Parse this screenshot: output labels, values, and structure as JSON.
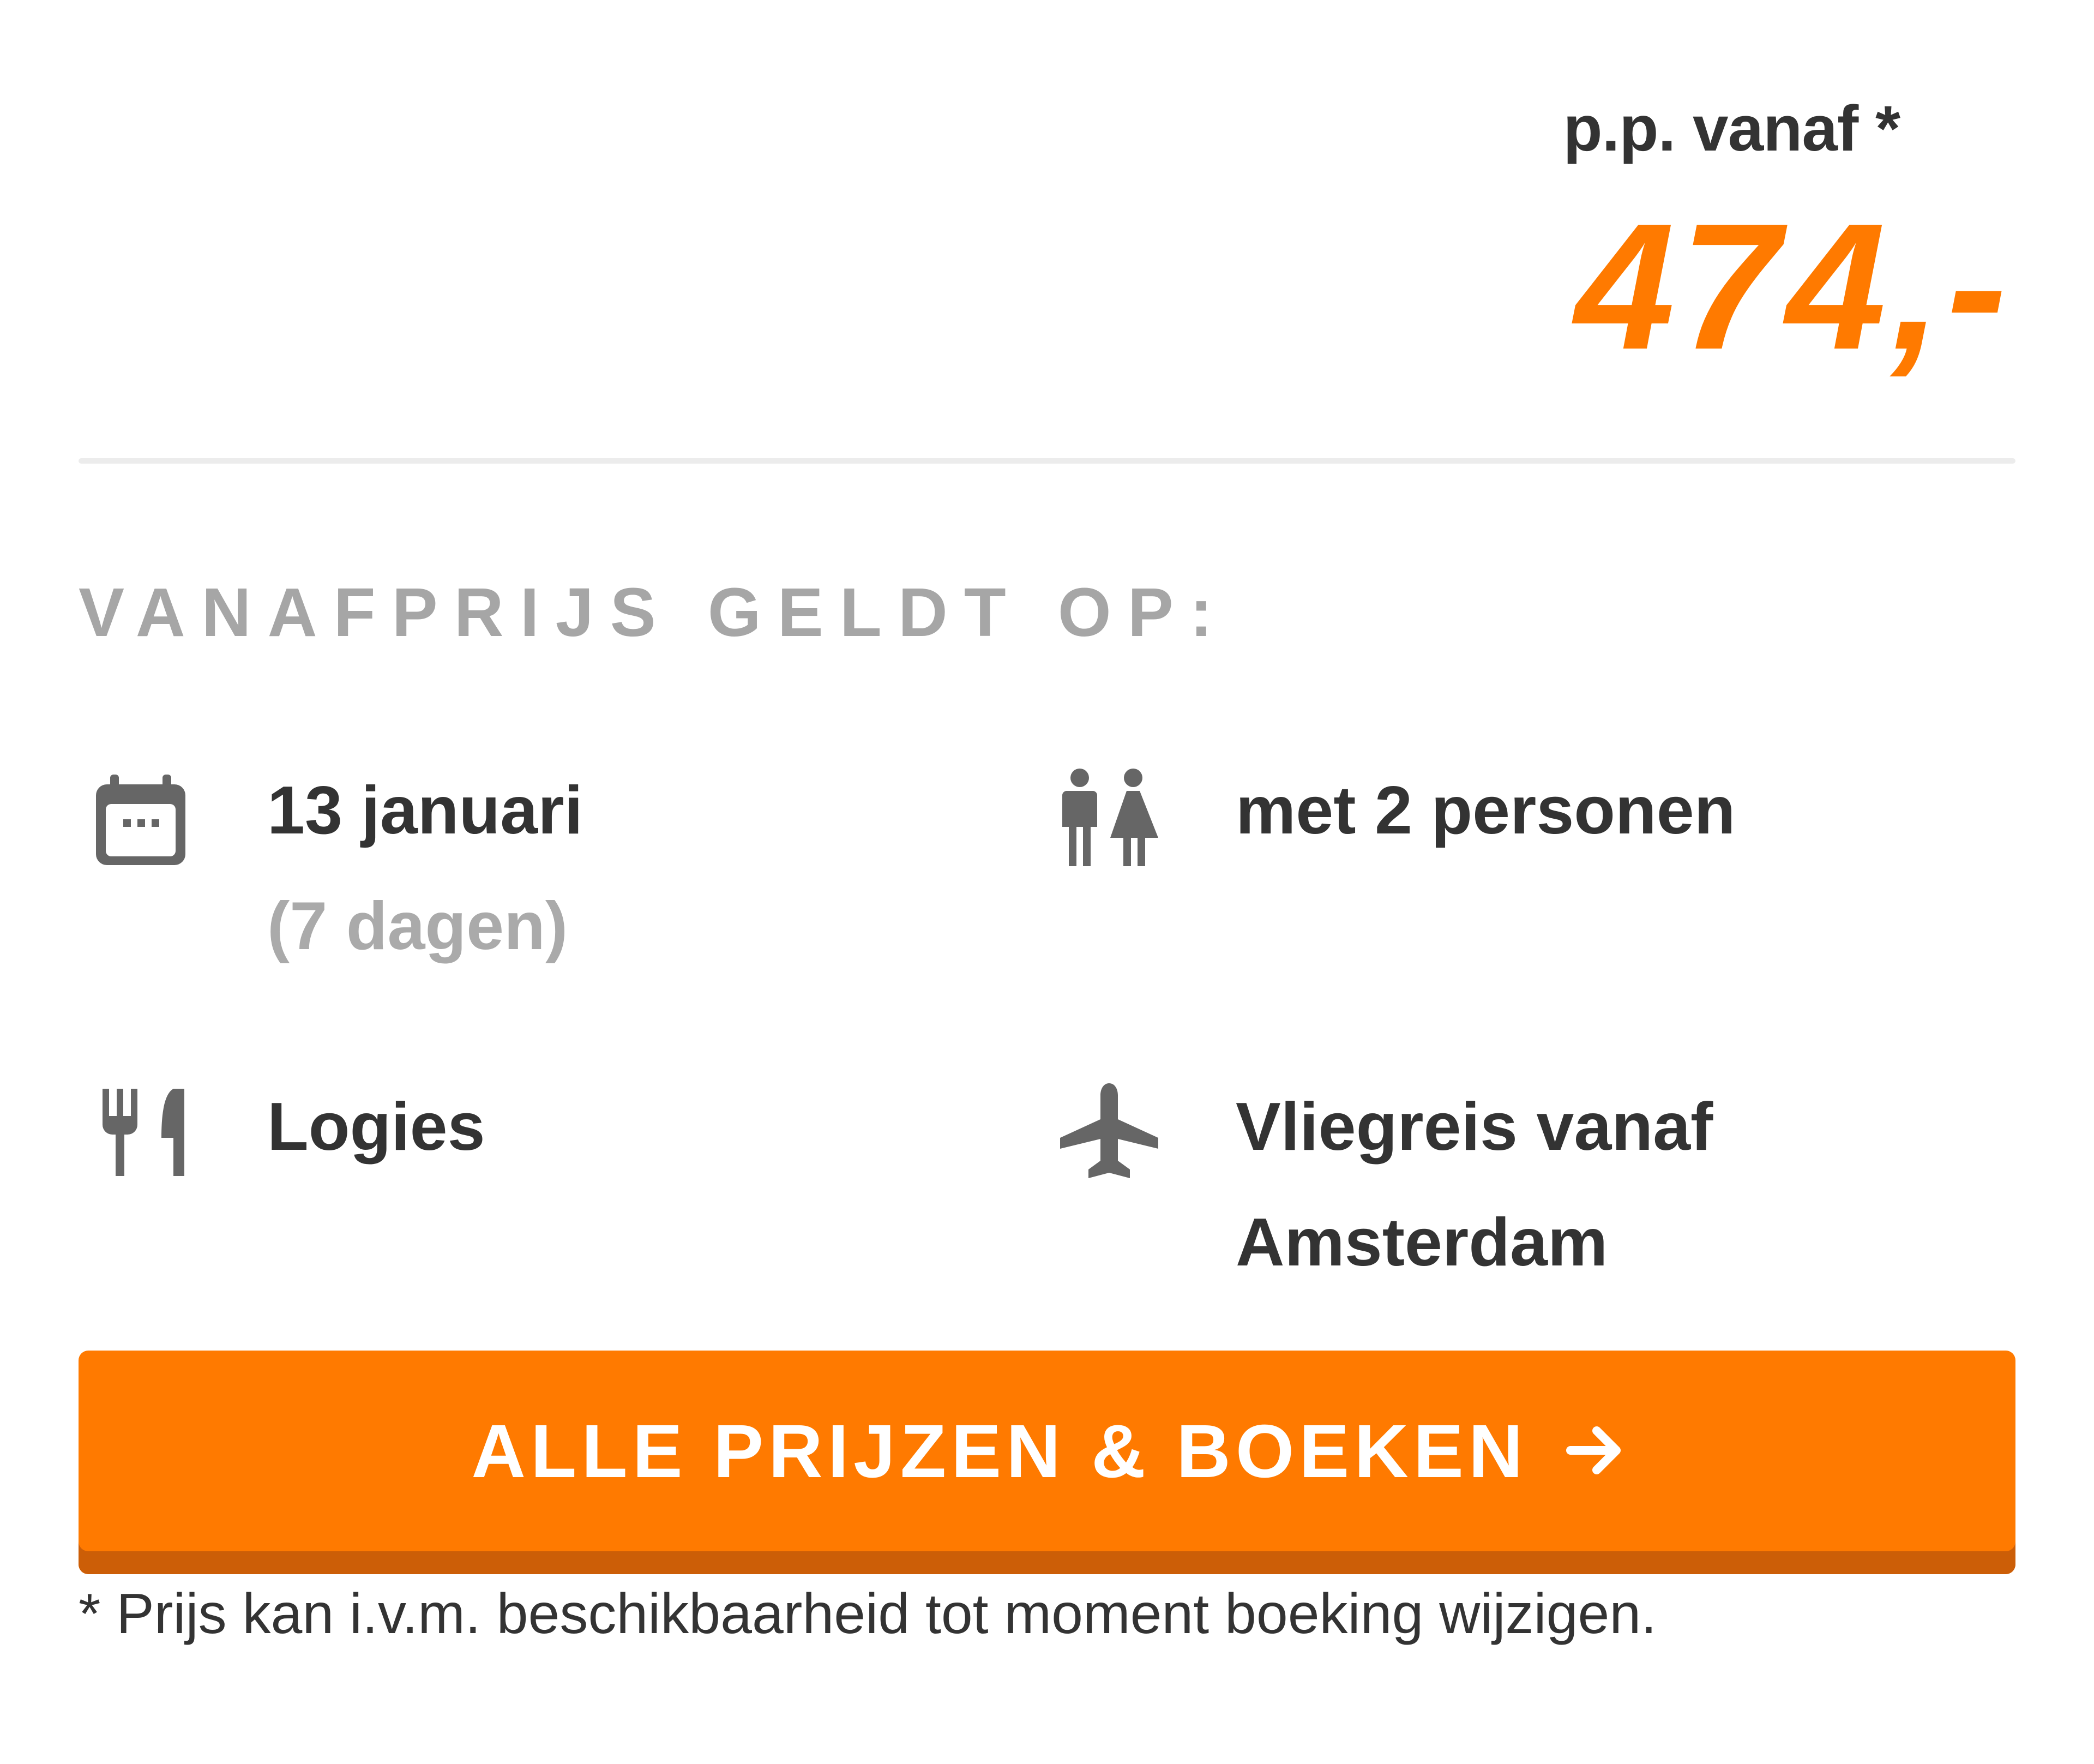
{
  "price": {
    "label": "p.p. vanaf *",
    "value": "474,-"
  },
  "section_title": "VANAFPRIJS GELDT OP:",
  "features": {
    "date": {
      "icon": "calendar-icon",
      "main": "13 januari",
      "sub": "(7 dagen)"
    },
    "persons": {
      "icon": "persons-icon",
      "main": "met 2 personen"
    },
    "meal": {
      "icon": "fork-knife-icon",
      "main": "Logies"
    },
    "flight": {
      "icon": "airplane-icon",
      "line1": "Vliegreis vanaf",
      "line2": "Amsterdam"
    }
  },
  "cta": {
    "label": "ALLE PRIJZEN & BOEKEN",
    "icon": "arrow-right-icon"
  },
  "footnote": "* Prijs kan i.v.m. beschikbaarheid tot moment boeking wijzigen.",
  "colors": {
    "accent": "#ff7a00",
    "accent_dark": "#cc5e07",
    "text": "#333333",
    "muted": "#a6a6a6",
    "icon": "#666666"
  }
}
